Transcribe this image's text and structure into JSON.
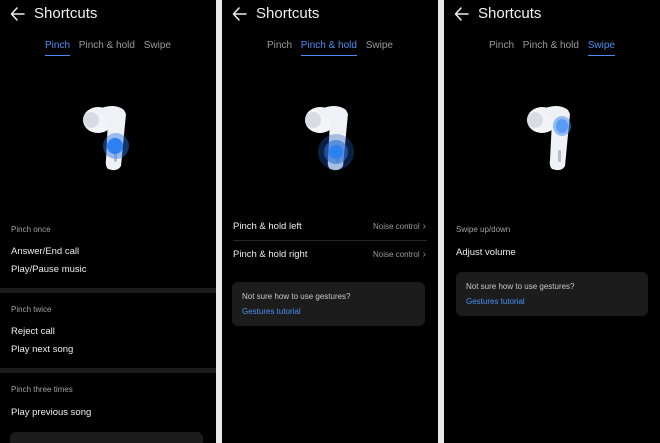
{
  "colors": {
    "accent": "#4a8ff0",
    "background": "#000000"
  },
  "screens": [
    {
      "title": "Shortcuts",
      "tabs": [
        {
          "label": "Pinch",
          "active": true
        },
        {
          "label": "Pinch & hold",
          "active": false
        },
        {
          "label": "Swipe",
          "active": false
        }
      ],
      "sections": [
        {
          "label": "Pinch once",
          "items": [
            "Answer/End call",
            "Play/Pause music"
          ]
        },
        {
          "label": "Pinch twice",
          "items": [
            "Reject call",
            "Play next song"
          ]
        },
        {
          "label": "Pinch three times",
          "items": [
            "Play previous song"
          ]
        }
      ]
    },
    {
      "title": "Shortcuts",
      "tabs": [
        {
          "label": "Pinch",
          "active": false
        },
        {
          "label": "Pinch & hold",
          "active": true
        },
        {
          "label": "Swipe",
          "active": false
        }
      ],
      "rows": [
        {
          "label": "Pinch & hold left",
          "value": "Noise control"
        },
        {
          "label": "Pinch & hold right",
          "value": "Noise control"
        }
      ],
      "help": {
        "question": "Not sure how to use gestures?",
        "link": "Gestures tutorial"
      }
    },
    {
      "title": "Shortcuts",
      "tabs": [
        {
          "label": "Pinch",
          "active": false
        },
        {
          "label": "Pinch & hold",
          "active": false
        },
        {
          "label": "Swipe",
          "active": true
        }
      ],
      "sections": [
        {
          "label": "Swipe up/down",
          "items": [
            "Adjust volume"
          ]
        }
      ],
      "help": {
        "question": "Not sure how to use gestures?",
        "link": "Gestures tutorial"
      }
    }
  ]
}
